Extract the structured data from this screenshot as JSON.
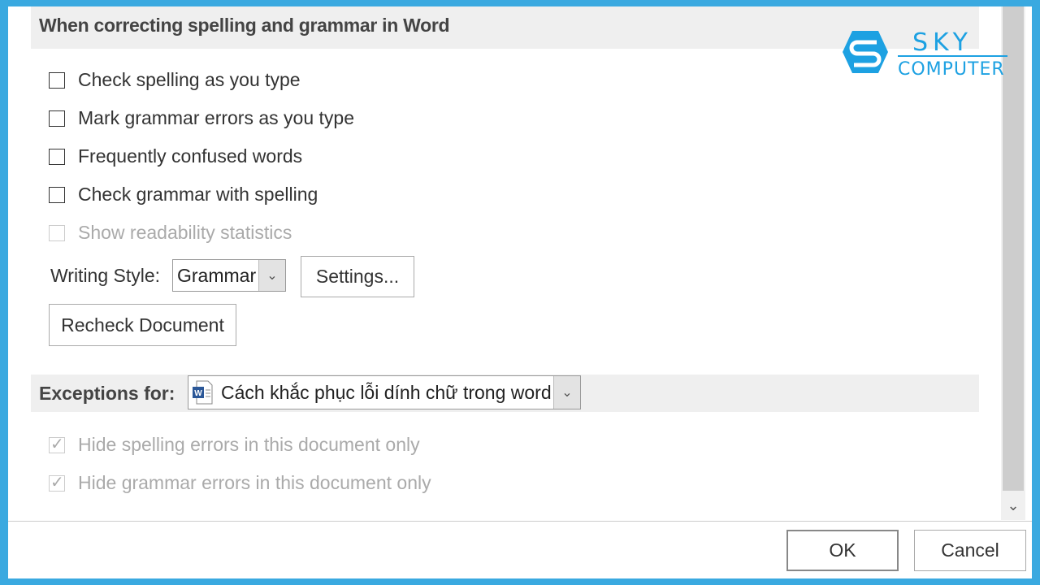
{
  "section_title": "When correcting spelling and grammar in Word",
  "options": [
    {
      "label": "Check spelling as you type",
      "checked": false,
      "enabled": true
    },
    {
      "label": "Mark grammar errors as you type",
      "checked": false,
      "enabled": true
    },
    {
      "label": "Frequently confused words",
      "checked": false,
      "enabled": true
    },
    {
      "label": "Check grammar with spelling",
      "checked": false,
      "enabled": true
    },
    {
      "label": "Show readability statistics",
      "checked": false,
      "enabled": false
    }
  ],
  "writing_style": {
    "label": "Writing Style:",
    "value": "Grammar"
  },
  "settings_button": "Settings...",
  "recheck_button": "Recheck Document",
  "exceptions": {
    "label": "Exceptions for:",
    "document": "Cách khắc phục lỗi dính chữ trong word"
  },
  "exception_options": [
    {
      "label": "Hide spelling errors in this document only",
      "checked": true,
      "enabled": false
    },
    {
      "label": "Hide grammar errors in this document only",
      "checked": true,
      "enabled": false
    }
  ],
  "ok_button": "OK",
  "cancel_button": "Cancel",
  "watermark": {
    "line1": "SKY",
    "line2": "COMPUTER"
  },
  "colors": {
    "frame": "#3aa9e0",
    "logo": "#1da1e2"
  }
}
